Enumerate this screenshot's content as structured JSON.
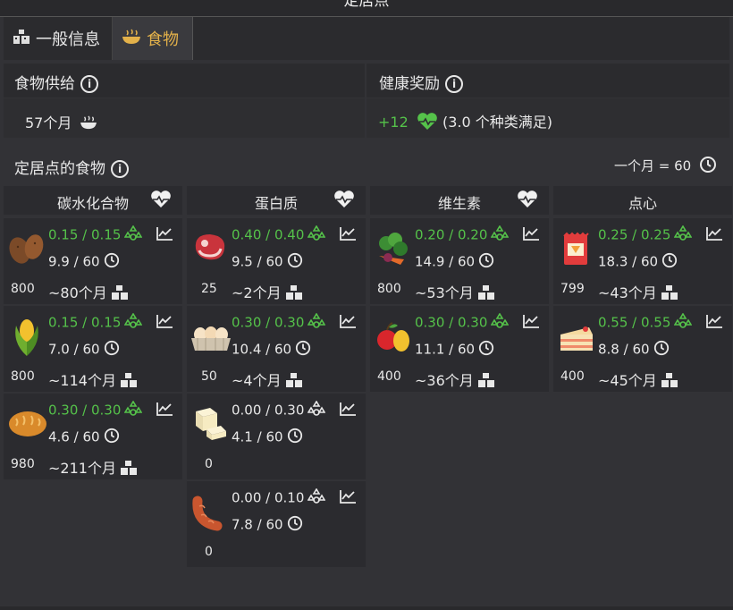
{
  "window": {
    "title": "定居点"
  },
  "tabs": [
    {
      "label": "一般信息",
      "icon": "building-icon",
      "active": false
    },
    {
      "label": "食物",
      "icon": "food-bowl-icon",
      "active": true
    }
  ],
  "food_supply": {
    "label": "食物供给",
    "value": "57个月"
  },
  "health_bonus": {
    "label": "健康奖励",
    "plus": "+12",
    "note": "(3.0 个种类满足)"
  },
  "settlement_food": {
    "label": "定居点的食物",
    "month_note": "一个月 = 60"
  },
  "columns": [
    {
      "title": "碳水化合物",
      "items": [
        {
          "name": "potato",
          "rate": "0.15 / 0.15",
          "store": "9.9 / 60",
          "months": "~80个月",
          "qty": "800",
          "satisfied": true
        },
        {
          "name": "corn",
          "rate": "0.15 / 0.15",
          "store": "7.0 / 60",
          "months": "~114个月",
          "qty": "800",
          "satisfied": true
        },
        {
          "name": "bread",
          "rate": "0.30 / 0.30",
          "store": "4.6 / 60",
          "months": "~211个月",
          "qty": "980",
          "satisfied": true
        }
      ]
    },
    {
      "title": "蛋白质",
      "items": [
        {
          "name": "meat",
          "rate": "0.40 / 0.40",
          "store": "9.5 / 60",
          "months": "~2个月",
          "qty": "25",
          "satisfied": true
        },
        {
          "name": "eggs",
          "rate": "0.30 / 0.30",
          "store": "10.4 / 60",
          "months": "~4个月",
          "qty": "50",
          "satisfied": true
        },
        {
          "name": "tofu",
          "rate": "0.00 / 0.30",
          "store": "4.1 / 60",
          "months": "",
          "qty": "0",
          "satisfied": false
        },
        {
          "name": "sausage",
          "rate": "0.00 / 0.10",
          "store": "7.8 / 60",
          "months": "",
          "qty": "0",
          "satisfied": false
        }
      ]
    },
    {
      "title": "维生素",
      "items": [
        {
          "name": "vegetables",
          "rate": "0.20 / 0.20",
          "store": "14.9 / 60",
          "months": "~53个月",
          "qty": "800",
          "satisfied": true
        },
        {
          "name": "fruit",
          "rate": "0.30 / 0.30",
          "store": "11.1 / 60",
          "months": "~36个月",
          "qty": "400",
          "satisfied": true
        }
      ]
    },
    {
      "title": "点心",
      "items": [
        {
          "name": "snack-bag",
          "rate": "0.25 / 0.25",
          "store": "18.3 / 60",
          "months": "~43个月",
          "qty": "799",
          "satisfied": true
        },
        {
          "name": "cake",
          "rate": "0.55 / 0.55",
          "store": "8.8 / 60",
          "months": "~45个月",
          "qty": "400",
          "satisfied": true
        }
      ]
    }
  ],
  "colors": {
    "accent": "#e3b14a",
    "green": "#55c24a",
    "panel": "#323236",
    "card": "#2b2b2f"
  }
}
